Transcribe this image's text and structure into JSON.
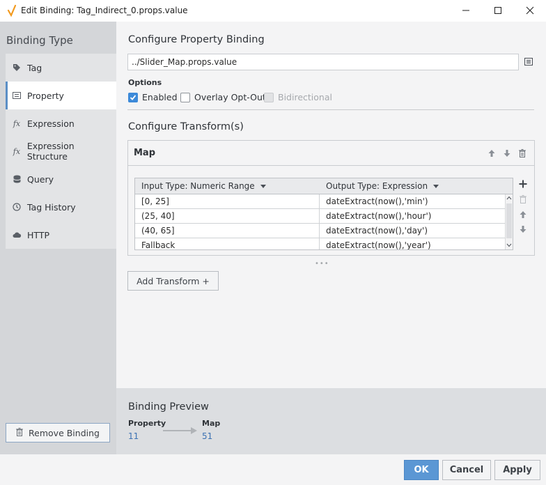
{
  "window": {
    "title": "Edit Binding: Tag_Indirect_0.props.value",
    "controls": [
      "minimize-icon",
      "maximize-icon",
      "close-icon"
    ]
  },
  "sidebar": {
    "title": "Binding Type",
    "items": [
      {
        "label": "Tag",
        "icon": "tag-icon"
      },
      {
        "label": "Property",
        "icon": "property-icon",
        "active": true
      },
      {
        "label": "Expression",
        "icon": "fx-icon"
      },
      {
        "label": "Expression Structure",
        "icon": "fx-icon"
      },
      {
        "label": "Query",
        "icon": "database-icon"
      },
      {
        "label": "Tag History",
        "icon": "history-icon"
      },
      {
        "label": "HTTP",
        "icon": "cloud-icon"
      }
    ],
    "remove_label": "Remove Binding"
  },
  "binding": {
    "heading": "Configure Property Binding",
    "path": "../Slider_Map.props.value",
    "options_label": "Options",
    "options": {
      "enabled": {
        "label": "Enabled",
        "checked": true
      },
      "overlay": {
        "label": "Overlay Opt-Out",
        "checked": false
      },
      "bidirectional": {
        "label": "Bidirectional",
        "checked": false,
        "disabled": true
      }
    }
  },
  "transforms": {
    "heading": "Configure Transform(s)",
    "map": {
      "title": "Map",
      "input_header": "Input Type: Numeric Range",
      "output_header": "Output Type: Expression",
      "rows": [
        {
          "input": "[0, 25]",
          "output": "dateExtract(now(),'min')"
        },
        {
          "input": "(25, 40]",
          "output": "dateExtract(now(),'hour')"
        },
        {
          "input": "(40, 65]",
          "output": "dateExtract(now(),'day')"
        },
        {
          "input": "Fallback",
          "output": "dateExtract(now(),'year')"
        }
      ]
    },
    "add_label": "Add Transform +"
  },
  "preview": {
    "heading": "Binding Preview",
    "source_label": "Property",
    "source_value": "11",
    "target_label": "Map",
    "target_value": "51"
  },
  "footer": {
    "ok": "OK",
    "cancel": "Cancel",
    "apply": "Apply"
  },
  "colors": {
    "accent": "#5b97d4",
    "checkbox": "#3d8ad9",
    "preview_value": "#3c72b3"
  }
}
